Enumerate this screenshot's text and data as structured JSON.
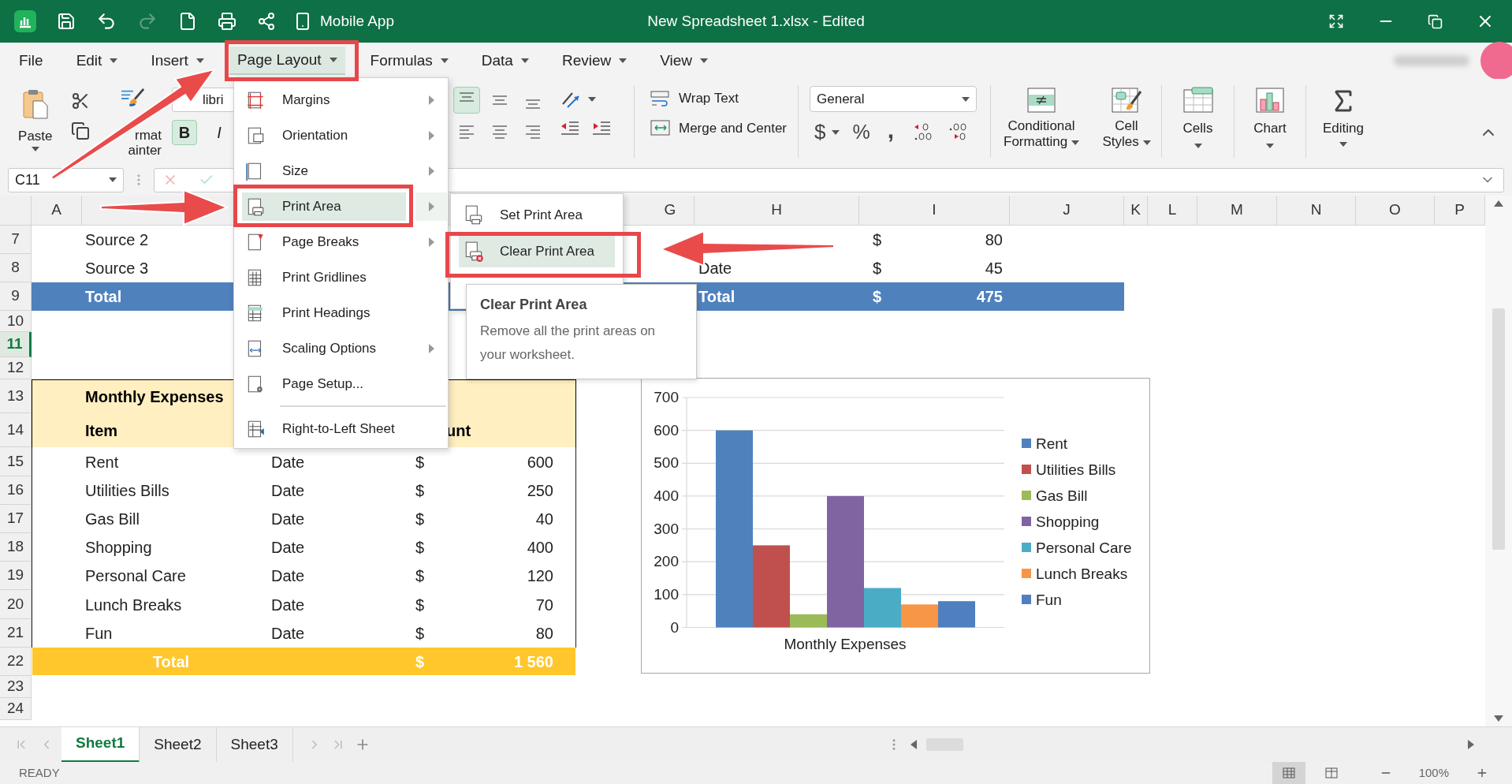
{
  "title_bar": {
    "quick_access_label": "Mobile App",
    "title": "New Spreadsheet 1.xlsx - Edited",
    "redo_disabled": true
  },
  "menu_bar": [
    {
      "label": "File",
      "dropdown": false,
      "selected": false
    },
    {
      "label": "Edit",
      "dropdown": true,
      "selected": false
    },
    {
      "label": "Insert",
      "dropdown": true,
      "selected": false
    },
    {
      "label": "Page Layout",
      "dropdown": true,
      "selected": true
    },
    {
      "label": "Formulas",
      "dropdown": true,
      "selected": false
    },
    {
      "label": "Data",
      "dropdown": true,
      "selected": false
    },
    {
      "label": "Review",
      "dropdown": true,
      "selected": false
    },
    {
      "label": "View",
      "dropdown": true,
      "selected": false
    }
  ],
  "ribbon": {
    "paste": "Paste",
    "format_painter": [
      "rmat",
      "ainter"
    ],
    "font_name": "libri",
    "bold": {
      "label": "B",
      "on": true
    },
    "italic": {
      "label": "I",
      "on": false
    },
    "vertical_align": [
      {
        "selected": true
      },
      {
        "selected": false
      },
      {
        "selected": false
      }
    ],
    "wrap_text": "Wrap Text",
    "merge_center": "Merge and Center",
    "number_format": "General",
    "currency": "$",
    "percent": "%",
    "comma": ",",
    "conditional_formatting": "Conditional Formatting",
    "cell_styles": "Cell Styles",
    "cells": "Cells",
    "chart": "Chart",
    "editing": "Editing"
  },
  "formula_bar": {
    "name_box": "C11"
  },
  "columns": {
    "left": [
      "A"
    ],
    "right": [
      "G",
      "H",
      "I",
      "J",
      "K",
      "L",
      "M",
      "N",
      "O",
      "P"
    ]
  },
  "rows": [
    {
      "number": "7",
      "selected": false,
      "kind": "plain",
      "cells": {
        "B": "Source 2",
        "I": {
          "symbol": "$",
          "amount": "80"
        }
      }
    },
    {
      "number": "8",
      "selected": false,
      "kind": "plain",
      "cells": {
        "B": "Source 3",
        "H": "Date",
        "I": {
          "symbol": "$",
          "amount": "45"
        }
      }
    },
    {
      "number": "9",
      "selected": false,
      "kind": "total",
      "cells": {
        "B": "Total",
        "H": "Total",
        "I": {
          "symbol": "$",
          "amount": "475"
        }
      }
    },
    {
      "number": "10",
      "selected": false,
      "kind": "plain"
    },
    {
      "number": "11",
      "selected": true,
      "kind": "plain"
    },
    {
      "number": "12",
      "selected": false,
      "kind": "plain"
    },
    {
      "number": "13",
      "selected": false,
      "kind": "header",
      "cells": {
        "B": "Monthly Expenses"
      }
    },
    {
      "number": "14",
      "selected": false,
      "kind": "header",
      "cells": {
        "B": "Item",
        "D": "unt"
      }
    },
    {
      "number": "15",
      "selected": false,
      "kind": "plain",
      "cells": {
        "B": "Rent",
        "C": "Date",
        "D": {
          "symbol": "$",
          "amount": "600"
        }
      }
    },
    {
      "number": "16",
      "selected": false,
      "kind": "plain",
      "cells": {
        "B": "Utilities Bills",
        "C": "Date",
        "D": {
          "symbol": "$",
          "amount": "250"
        }
      }
    },
    {
      "number": "17",
      "selected": false,
      "kind": "plain",
      "cells": {
        "B": "Gas Bill",
        "C": "Date",
        "D": {
          "symbol": "$",
          "amount": "40"
        }
      }
    },
    {
      "number": "18",
      "selected": false,
      "kind": "plain",
      "cells": {
        "B": "Shopping",
        "C": "Date",
        "D": {
          "symbol": "$",
          "amount": "400"
        }
      }
    },
    {
      "number": "19",
      "selected": false,
      "kind": "plain",
      "cells": {
        "B": "Personal Care",
        "C": "Date",
        "D": {
          "symbol": "$",
          "amount": "120"
        }
      }
    },
    {
      "number": "20",
      "selected": false,
      "kind": "plain",
      "cells": {
        "B": "Lunch Breaks",
        "C": "Date",
        "D": {
          "symbol": "$",
          "amount": "70"
        }
      }
    },
    {
      "number": "21",
      "selected": false,
      "kind": "plain",
      "cells": {
        "B": "Fun",
        "C": "Date",
        "D": {
          "symbol": "$",
          "amount": "80"
        }
      }
    },
    {
      "number": "22",
      "selected": false,
      "kind": "grand-total",
      "cells": {
        "B": "Total",
        "D": {
          "symbol": "$",
          "amount": "1 560"
        }
      }
    },
    {
      "number": "23",
      "selected": false,
      "kind": "plain"
    },
    {
      "number": "24",
      "selected": false,
      "kind": "plain"
    }
  ],
  "chart": {
    "chart_data": {
      "type": "bar",
      "grid": true,
      "legend": true,
      "categories": [
        "Monthly Expenses"
      ],
      "ylim": [
        0,
        700
      ],
      "yticks": [
        {
          "value": 0,
          "label": "0"
        },
        {
          "value": 100,
          "label": "100"
        },
        {
          "value": 200,
          "label": "200"
        },
        {
          "value": 300,
          "label": "300"
        },
        {
          "value": 400,
          "label": "400"
        },
        {
          "value": 500,
          "label": "500"
        },
        {
          "value": 600,
          "label": "600"
        },
        {
          "value": 700,
          "label": "700"
        }
      ],
      "series": [
        {
          "name": "Rent",
          "color": "#4f81bd",
          "values": [
            600
          ]
        },
        {
          "name": "Utilities Bills",
          "color": "#c0504d",
          "values": [
            250
          ]
        },
        {
          "name": "Gas Bill",
          "color": "#9bbb59",
          "values": [
            40
          ]
        },
        {
          "name": "Shopping",
          "color": "#8064a2",
          "values": [
            400
          ]
        },
        {
          "name": "Personal Care",
          "color": "#4bacc6",
          "values": [
            120
          ]
        },
        {
          "name": "Lunch Breaks",
          "color": "#f79646",
          "values": [
            70
          ]
        },
        {
          "name": "Fun",
          "color": "#4f7fbe",
          "values": [
            80
          ]
        }
      ]
    }
  },
  "sheet_tabs": [
    {
      "label": "Sheet1",
      "selected": true
    },
    {
      "label": "Sheet2",
      "selected": false
    },
    {
      "label": "Sheet3",
      "selected": false
    }
  ],
  "status_bar": {
    "status": "READY",
    "zoom": "100%",
    "views": [
      {
        "selected": true
      },
      {
        "selected": false
      }
    ]
  },
  "page_layout_menu": {
    "items": [
      {
        "label": "Margins",
        "submenu": true,
        "selected": false,
        "separator_before": false
      },
      {
        "label": "Orientation",
        "submenu": true,
        "selected": false,
        "separator_before": false
      },
      {
        "label": "Size",
        "submenu": true,
        "selected": false,
        "separator_before": false
      },
      {
        "label": "Print Area",
        "submenu": true,
        "selected": true,
        "separator_before": false
      },
      {
        "label": "Page Breaks",
        "submenu": true,
        "selected": false,
        "separator_before": false
      },
      {
        "label": "Print Gridlines",
        "submenu": false,
        "selected": false,
        "separator_before": false
      },
      {
        "label": "Print Headings",
        "submenu": false,
        "selected": false,
        "separator_before": false
      },
      {
        "label": "Scaling Options",
        "submenu": true,
        "selected": false,
        "separator_before": false
      },
      {
        "label": "Page Setup...",
        "submenu": false,
        "selected": false,
        "separator_before": false
      },
      {
        "label": "Right-to-Left Sheet",
        "submenu": false,
        "selected": false,
        "separator_before": true
      }
    ]
  },
  "print_area_submenu": {
    "items": [
      {
        "label": "Set Print Area",
        "selected": false
      },
      {
        "label": "Clear Print Area",
        "selected": true
      }
    ]
  },
  "tooltip": {
    "title": "Clear Print Area",
    "text": "Remove all the print areas on your worksheet."
  }
}
